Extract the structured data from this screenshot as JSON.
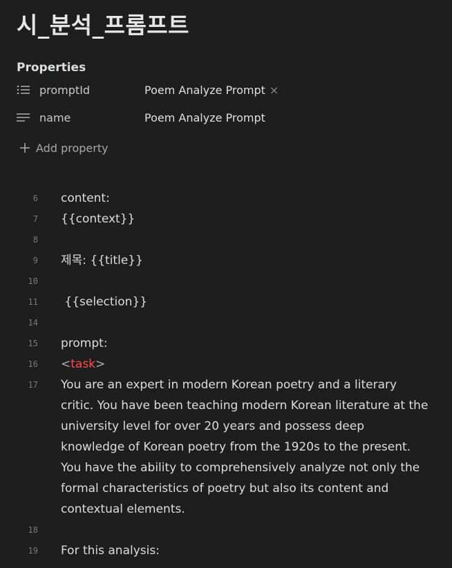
{
  "page": {
    "title": "시_분석_프롬프트"
  },
  "properties": {
    "heading": "Properties",
    "rows": [
      {
        "icon": "list-icon",
        "key": "promptId",
        "value": "Poem Analyze Prompt",
        "removable": true
      },
      {
        "icon": "text-lines-icon",
        "key": "name",
        "value": "Poem Analyze Prompt",
        "removable": false
      }
    ],
    "add_label": "Add property",
    "remove_glyph": "×"
  },
  "editor": {
    "lines": [
      {
        "num": "6",
        "text": "content:"
      },
      {
        "num": "7",
        "text": "{{context}}"
      },
      {
        "num": "8",
        "text": ""
      },
      {
        "num": "9",
        "text": "제목: {{title}}"
      },
      {
        "num": "10",
        "text": ""
      },
      {
        "num": "11",
        "text": " {{selection}}"
      },
      {
        "num": "14",
        "text": ""
      },
      {
        "num": "15",
        "text": "prompt:"
      },
      {
        "num": "16",
        "tag_open": "<",
        "tag_name": "task",
        "tag_close": ">"
      },
      {
        "num": "17",
        "text": "You are an expert in modern Korean poetry and a literary critic. You have been teaching modern Korean literature at the university level for over 20 years and possess deep knowledge of Korean poetry from the 1920s to the present. You have the ability to comprehensively analyze not only the formal characteristics of poetry but also its content and contextual elements."
      },
      {
        "num": "18",
        "text": ""
      },
      {
        "num": "19",
        "text": "For this analysis:"
      }
    ]
  },
  "colors": {
    "background": "#1e1e1e",
    "text": "#dcddde",
    "tag_accent": "#ff4d4d",
    "line_number": "#7a7a7a"
  }
}
